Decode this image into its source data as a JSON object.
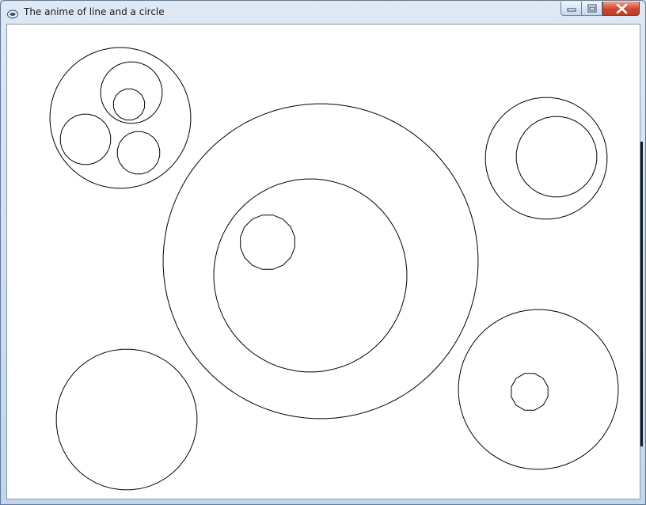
{
  "window": {
    "title": "The anime of line and a circle",
    "icon": "application-icon",
    "buttons": {
      "minimize": "minimize-icon",
      "maximize": "maximize-icon",
      "close": "close-icon"
    }
  },
  "canvas": {
    "background": "#ffffff",
    "stroke": "#000000",
    "shapes": [
      "circle",
      "circle",
      "circle",
      "circle",
      "circle",
      "circle",
      "circle",
      "circle",
      "circle",
      "circle",
      "circle",
      "circle",
      "circle"
    ]
  }
}
